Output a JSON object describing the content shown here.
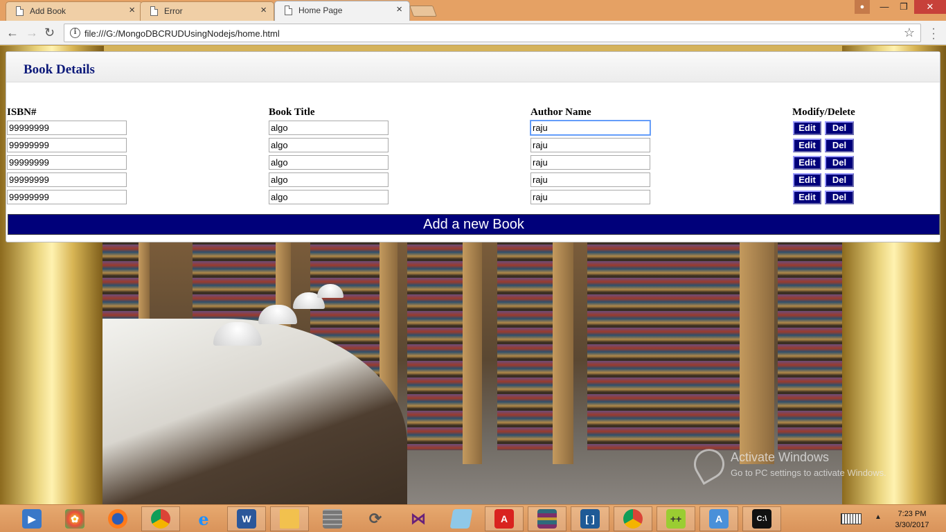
{
  "browser": {
    "tabs": [
      {
        "title": "Add Book",
        "active": false
      },
      {
        "title": "Error",
        "active": false
      },
      {
        "title": "Home Page",
        "active": true
      }
    ],
    "close_glyph": "×",
    "url": "file:///G:/MongoDBCRUDUsingNodejs/home.html",
    "icons": {
      "back": "arrow-left-icon",
      "forward": "arrow-right-icon",
      "reload": "reload-icon",
      "info": "info-icon",
      "star": "star-icon",
      "menu": "menu-dots-icon"
    }
  },
  "panel": {
    "title": "Book Details",
    "columns": {
      "isbn": "ISBN#",
      "title": "Book Title",
      "author": "Author Name",
      "actions": "Modify/Delete"
    },
    "rows": [
      {
        "isbn": "99999999",
        "title": "algo",
        "author": "raju",
        "focused": true
      },
      {
        "isbn": "99999999",
        "title": "algo",
        "author": "raju"
      },
      {
        "isbn": "99999999",
        "title": "algo",
        "author": "raju"
      },
      {
        "isbn": "99999999",
        "title": "algo",
        "author": "raju"
      },
      {
        "isbn": "99999999",
        "title": "algo",
        "author": "raju"
      }
    ],
    "edit_label": "Edit",
    "delete_label": "Del",
    "add_label": "Add a new Book"
  },
  "colors": {
    "accent": "#00007a",
    "title": "#0d1a7a",
    "chrome": "#e5a164"
  },
  "watermark": {
    "line1": "Activate Windows",
    "line2": "Go to PC settings to activate Windows."
  },
  "taskbar": {
    "apps": [
      "media-center-icon",
      "paint-icon",
      "firefox-icon",
      "chrome-icon",
      "internet-explorer-icon",
      "word-icon",
      "file-explorer-icon",
      "firewall-icon",
      "sync-icon",
      "visual-studio-icon",
      "notepad-icon",
      "acrobat-icon",
      "winrar-icon",
      "brackets-icon",
      "chrome-icon",
      "notepad-plus-icon",
      "wordpad-icon",
      "command-prompt-icon"
    ],
    "time": "7:23 PM",
    "date": "3/30/2017"
  }
}
